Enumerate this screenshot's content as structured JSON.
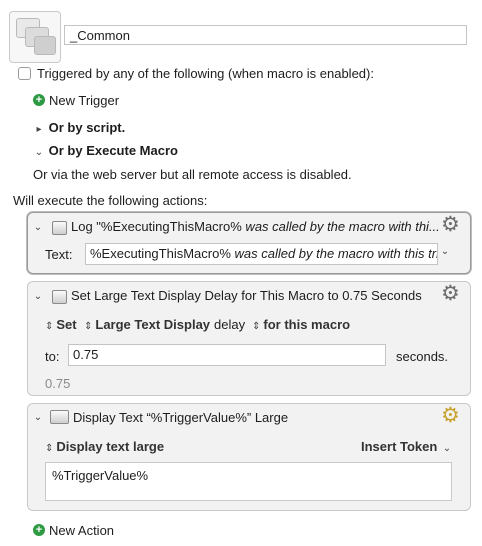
{
  "macro": {
    "name": "_Common"
  },
  "trigger": {
    "checkbox_label": "Triggered by any of the following (when macro is enabled):",
    "new_trigger_label": "New Trigger",
    "or_by_script_label": "Or by script.",
    "or_by_execute_macro_label": "Or by Execute Macro",
    "web_server_text": "Or via the web server but all remote access is disabled."
  },
  "actions_heading": "Will execute the following actions:",
  "actions": [
    {
      "title_prefix": "Log \"%ExecutingThisMacro%",
      "title_italic": " was called by the macro with thi...",
      "text_label": "Text:",
      "text_value_plain": "%ExecutingThisMacro%",
      "text_value_italic": " was called by the macro with this trig"
    },
    {
      "title": "Set Large Text Display Delay for This Macro to 0.75 Seconds",
      "set_popup": "Set",
      "display_popup": "Large Text Display",
      "delay_label": "delay",
      "scope_popup": "for this macro",
      "to_label": "to:",
      "to_value": "0.75",
      "seconds_label": "seconds.",
      "result_value": "0.75"
    },
    {
      "title": "Display Text “%TriggerValue%” Large",
      "display_popup": "Display text large",
      "insert_token_label": "Insert Token",
      "body_text": "%TriggerValue%"
    }
  ],
  "new_action_label": "New Action",
  "colors": {
    "plus_green": "#2e9a43",
    "gear_gray": "#6d6d6d",
    "gear_yellow": "#c9a330",
    "panel_bg": "#f2f2f2"
  },
  "icons": [
    "macro-group-icon",
    "plus-icon",
    "chevron-down-icon",
    "up-down-arrows-icon",
    "gear-icon",
    "action-window-icon"
  ]
}
